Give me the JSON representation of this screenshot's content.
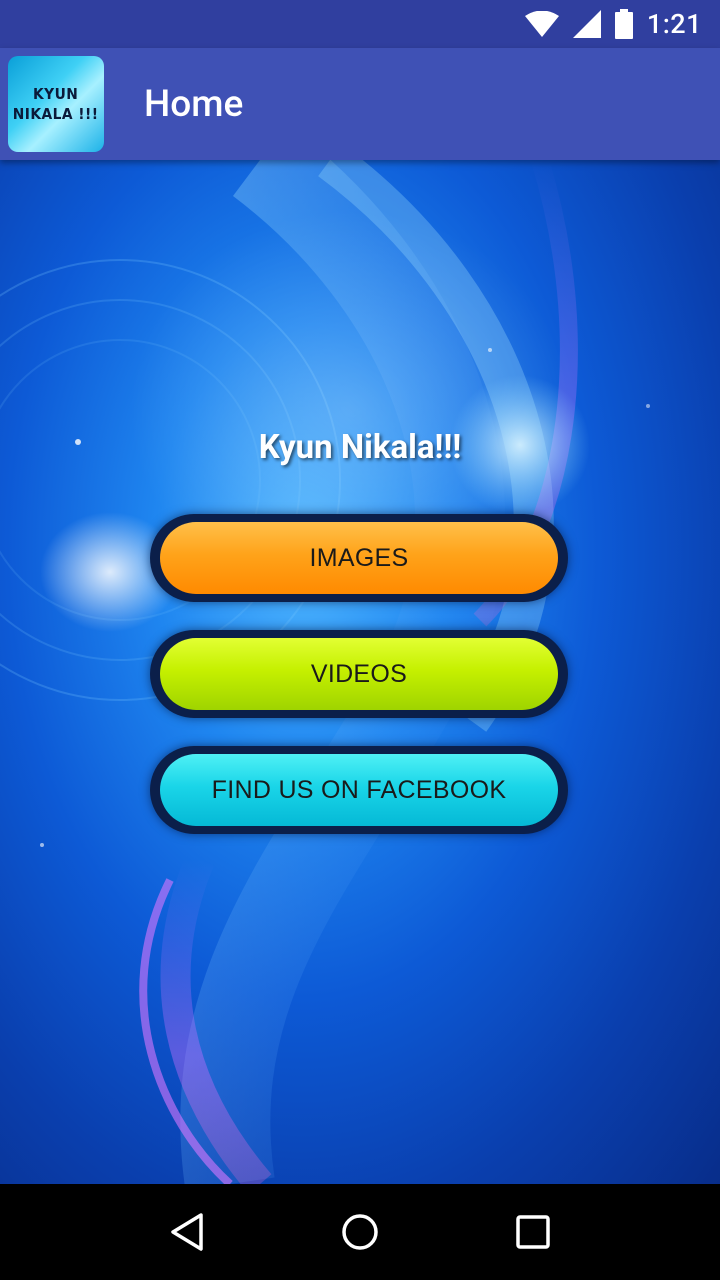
{
  "status_bar": {
    "time": "1:21",
    "icons": [
      "wifi-icon",
      "signal-icon",
      "battery-icon"
    ]
  },
  "app_bar": {
    "icon_line1": "KYUN",
    "icon_line2": "NIKALA !!!",
    "title": "Home",
    "color": "#3f51b5"
  },
  "main": {
    "headline": "Kyun Nikala!!!",
    "buttons": {
      "images": "IMAGES",
      "videos": "VIDEOS",
      "facebook": "FIND US ON FACEBOOK"
    }
  },
  "nav_bar": {
    "icons": [
      "back-icon",
      "home-icon",
      "recents-icon"
    ]
  }
}
